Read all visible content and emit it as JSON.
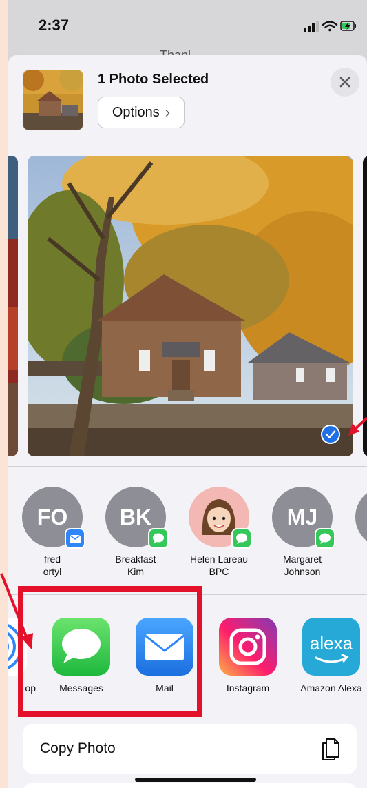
{
  "status_bar": {
    "time": "2:37"
  },
  "background_app": {
    "title_peek": "Thanl"
  },
  "share_sheet": {
    "title": "1 Photo Selected",
    "options_label": "Options",
    "options_chevron": "›",
    "close_icon": "close-icon"
  },
  "contacts": [
    {
      "initials": "FO",
      "name_line1": "fred",
      "name_line2": "ortyl",
      "badge": "mail-icon"
    },
    {
      "initials": "BK",
      "name_line1": "Breakfast",
      "name_line2": "Kim",
      "badge": "messages-icon"
    },
    {
      "initials": "",
      "name_line1": "Helen Lareau",
      "name_line2": "BPC",
      "badge": "messages-icon",
      "avatar": "memoji-avatar"
    },
    {
      "initials": "MJ",
      "name_line1": "Margaret",
      "name_line2": "Johnson",
      "badge": "messages-icon"
    }
  ],
  "apps": [
    {
      "label": "op",
      "icon": "airdrop-icon"
    },
    {
      "label": "Messages",
      "icon": "messages-app-icon"
    },
    {
      "label": "Mail",
      "icon": "mail-app-icon"
    },
    {
      "label": "Instagram",
      "icon": "instagram-app-icon"
    },
    {
      "label": "Amazon Alexa",
      "icon": "alexa-app-icon",
      "icon_text": "alexa"
    }
  ],
  "actions": [
    {
      "label": "Copy Photo",
      "icon": "copy-icon"
    }
  ],
  "colors": {
    "highlight": "#e3122a",
    "messages_green": "#34c759",
    "mail_blue": "#2f86f6",
    "alexa_teal": "#26a9d6",
    "check_blue": "#1f6fe5"
  }
}
